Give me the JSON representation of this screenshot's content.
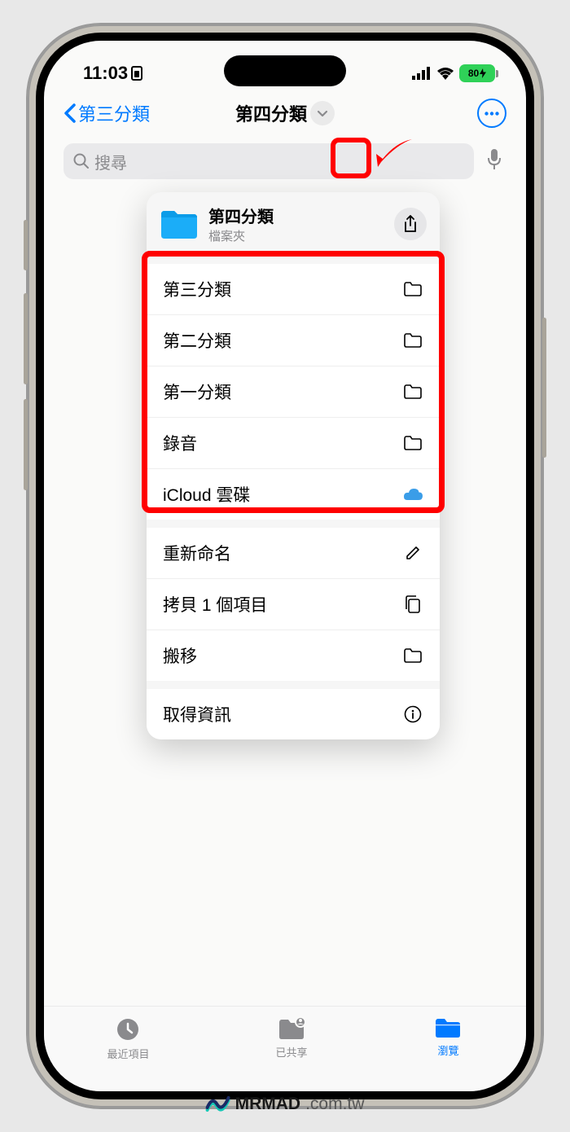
{
  "status": {
    "time": "11:03",
    "battery": "80"
  },
  "nav": {
    "back_label": "第三分類",
    "title": "第四分類"
  },
  "search": {
    "placeholder": "搜尋"
  },
  "dropdown": {
    "header": {
      "title": "第四分類",
      "subtitle": "檔案夾"
    },
    "folders": [
      {
        "label": "第三分類",
        "icon": "folder"
      },
      {
        "label": "第二分類",
        "icon": "folder"
      },
      {
        "label": "第一分類",
        "icon": "folder"
      },
      {
        "label": "錄音",
        "icon": "folder"
      },
      {
        "label": "iCloud 雲碟",
        "icon": "icloud"
      }
    ],
    "actions": [
      {
        "label": "重新命名",
        "icon": "pencil"
      },
      {
        "label": "拷貝 1 個項目",
        "icon": "copy"
      },
      {
        "label": "搬移",
        "icon": "folder"
      }
    ],
    "info": {
      "label": "取得資訊",
      "icon": "info"
    }
  },
  "tabs": [
    {
      "label": "最近項目"
    },
    {
      "label": "已共享"
    },
    {
      "label": "瀏覽"
    }
  ],
  "watermark": {
    "brand": "MRMAD",
    "domain": ".com.tw"
  }
}
